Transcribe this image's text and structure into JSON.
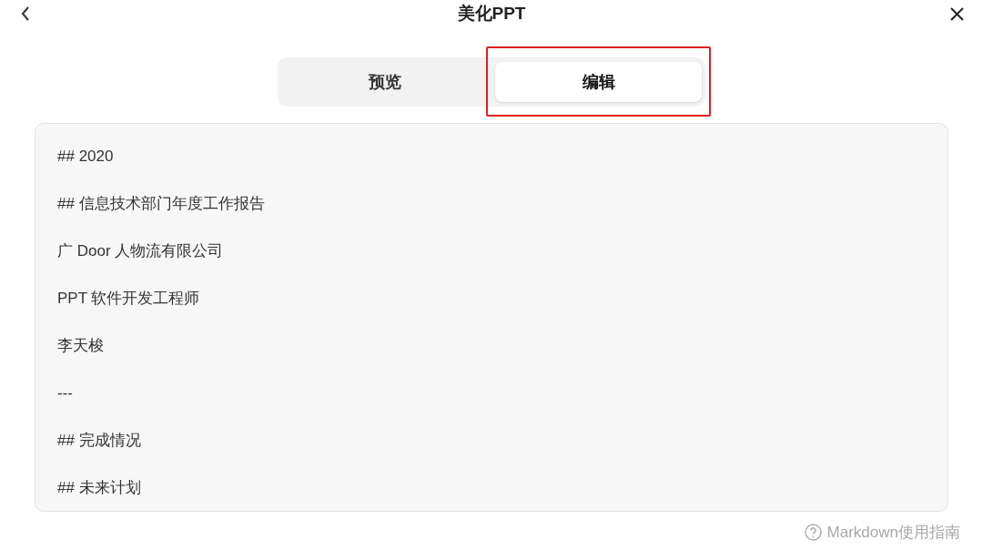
{
  "header": {
    "title": "美化PPT"
  },
  "tabs": [
    {
      "label": "预览",
      "selected": false,
      "highlighted": false
    },
    {
      "label": "编辑",
      "selected": true,
      "highlighted": true
    }
  ],
  "editor": {
    "lines": [
      "## 2020",
      "## 信息技术部门年度工作报告",
      "广 Door 人物流有限公司",
      "PPT 软件开发工程师",
      "李天梭",
      "---",
      "## 完成情况",
      "## 未来计划"
    ]
  },
  "footer": {
    "help_link": "Markdown使用指南"
  }
}
